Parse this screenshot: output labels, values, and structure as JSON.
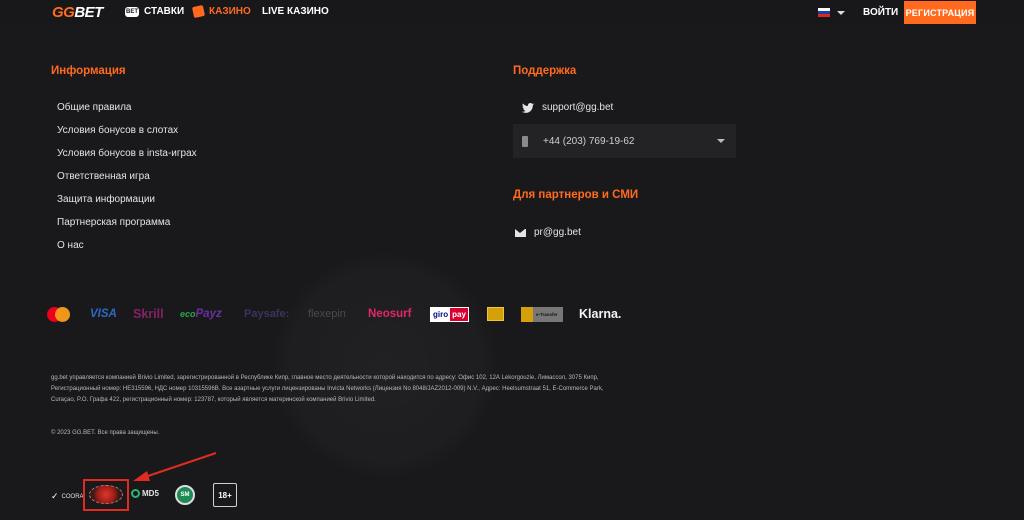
{
  "header": {
    "logo_gg": "GG",
    "logo_bet": "BET",
    "nav": [
      {
        "label": "СТАВКИ",
        "icon": "bet-icon",
        "icon_text": "BET"
      },
      {
        "label": "КАЗИНО",
        "icon": "casino-cards-icon"
      },
      {
        "label": "LIVE КАЗИНО"
      }
    ],
    "language_flag": "russian-flag-icon",
    "login_label": "ВОЙТИ",
    "register_label": "РЕГИСТРАЦИЯ"
  },
  "info": {
    "title": "Информация",
    "links": [
      "Общие правила",
      "Условия бонусов в слотах",
      "Условия бонусов в insta-играх",
      "Ответственная игра",
      "Защита информации",
      "Партнерская программа",
      "О нас"
    ]
  },
  "support": {
    "title": "Поддержка",
    "email": "support@gg.bet",
    "phone": "+44 (203) 769-19-62"
  },
  "partners": {
    "title": "Для партнеров и СМИ",
    "email": "pr@gg.bet"
  },
  "payments": {
    "visa": "VISA",
    "skrill": "Skrill",
    "ecopayz_eco": "eco",
    "ecopayz_payz": "Payz",
    "paysafe": "Paysafe:",
    "flexepin": "flexepin",
    "neosurf": "Neosurf",
    "giropay_giro": "giro",
    "giropay_pay": "pay",
    "bank_transfer": "e-Transfer",
    "klarna": "Klarna."
  },
  "legal": {
    "text": "gg.bet управляется компанией Brivio Limited, зарегистрированной в Республике Кипр, главное место деятельности которой находится по адресу: Офис 102, 12А Lekorgouzie, Лимассол, 3075 Кипр, Регистрационный номер: HE315596, НДС номер 10315596B. Все азартные услуги лицензированы Invicta Networks (Лицензия No 8048/JAZ2012-009) N.V., Адрес: Heelsumstraat 51, E-Commerce Park, Curaçao, P.O. Графа 422, регистрационный номер: 123787, который является материнской компанией Brivio Limited.",
    "copyright": "© 2023 GG.BET. Все права защищены."
  },
  "certificates": {
    "coora": "COORA",
    "md5": "MD5",
    "sm": "SM",
    "age": "18+"
  },
  "colors": {
    "accent": "#ff6a1f",
    "background": "#19191b",
    "annotation": "#e02b20"
  }
}
